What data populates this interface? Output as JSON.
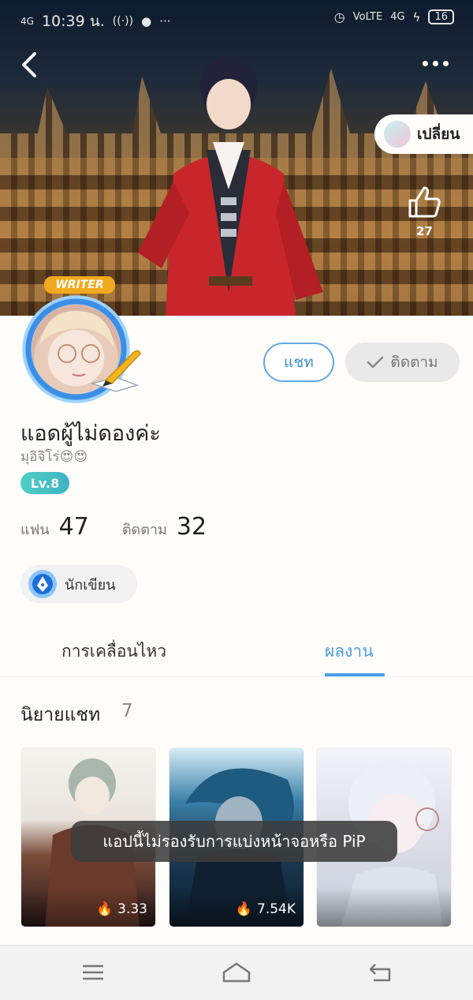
{
  "status_bar": {
    "network": "4G",
    "time": "10:39 น.",
    "volte": "VoLTE",
    "network2": "4G",
    "battery": "16"
  },
  "header": {
    "change_label": "เปลี่ยน",
    "like_count": "27"
  },
  "profile": {
    "writer_badge": "WRITER",
    "name": "แอดผู้ไม่ดองค่ะ",
    "subname": "มุอิจิโร่😍😍",
    "level": "Lv.8",
    "chat_label": "แชท",
    "follow_label": "ติดตาม"
  },
  "stats": {
    "fans_label": "แฟน",
    "fans_value": "47",
    "following_label": "ติดตาม",
    "following_value": "32"
  },
  "role": {
    "label": "นักเขียน"
  },
  "tabs": {
    "activity": "การเคลื่อนไหว",
    "works": "ผลงาน"
  },
  "section": {
    "title": "นิยายแชท",
    "count": "7"
  },
  "cards": [
    {
      "stat": "3.33"
    },
    {
      "stat": "7.54K"
    },
    {
      "stat": ""
    }
  ],
  "toast": "แอปนี้ไม่รองรับการแบ่งหน้าจอหรือ PiP",
  "colors": {
    "accent": "#4a9ee6",
    "level_gradient": "#4fd0c4",
    "background": "#fffdfa"
  },
  "icons": {
    "back": "chevron-left-icon",
    "more": "more-dots-icon",
    "like": "thumbs-up-icon",
    "follow_check": "check-icon",
    "role": "pen-nib-icon",
    "fire": "fire-icon",
    "nav_menu": "menu-icon",
    "nav_home": "home-icon",
    "nav_back": "back-arrow-icon"
  }
}
